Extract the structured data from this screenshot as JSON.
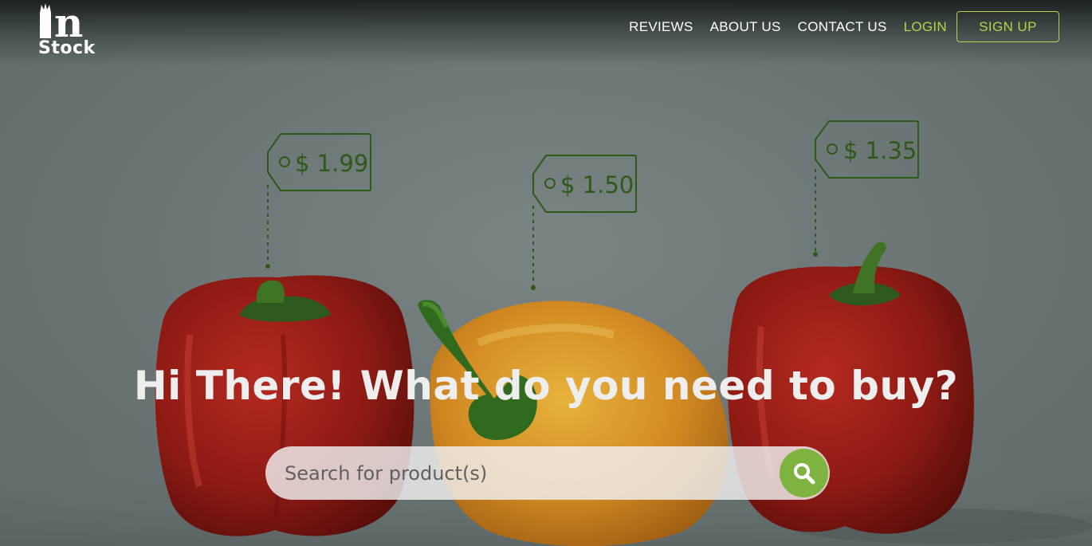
{
  "brand": {
    "logo_letter": "n",
    "logo_word": "Stock"
  },
  "nav": {
    "reviews": "REVIEWS",
    "about": "ABOUT US",
    "contact": "CONTACT US",
    "login": "LOGIN",
    "signup": "SIGN UP"
  },
  "hero": {
    "price_tags": [
      "$ 1.99",
      "$ 1.50",
      "$ 1.35"
    ],
    "headline": "Hi There! What do you need to buy?"
  },
  "search": {
    "placeholder": "Search for product(s)",
    "button_icon": "search-icon"
  },
  "colors": {
    "accent": "#b8d445",
    "search_button": "#7fb340",
    "tag_green": "#2d5a17"
  }
}
